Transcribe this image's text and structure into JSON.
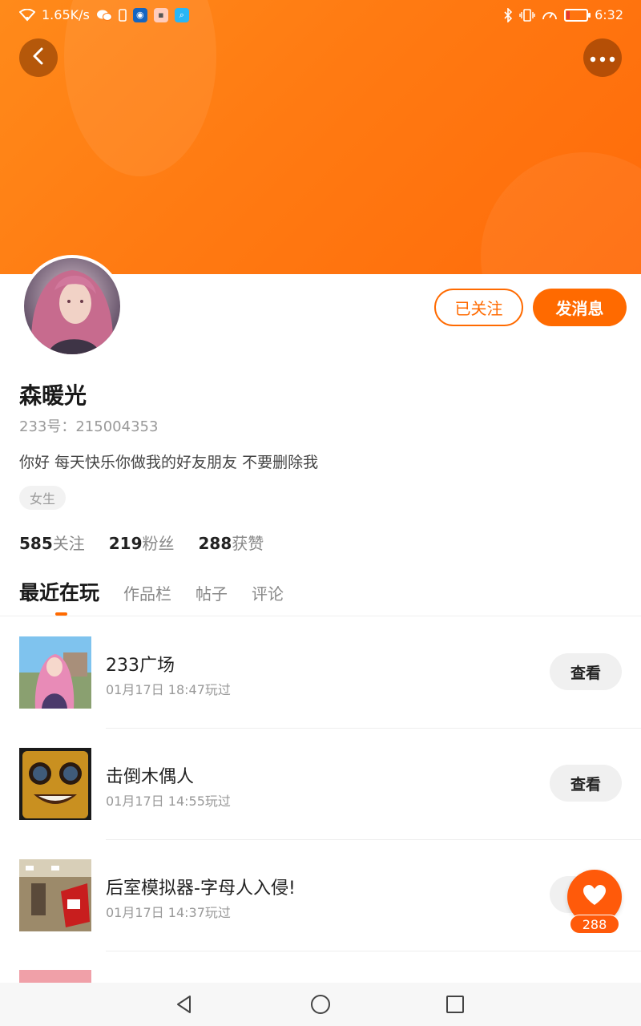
{
  "status_bar": {
    "speed": "1.65K/s",
    "time": "6:32",
    "icons": [
      "wifi-icon",
      "wechat-icon",
      "phone-icon",
      "app-bulb-icon",
      "app-chat-icon",
      "app-search-icon",
      "bluetooth-icon",
      "vibrate-icon",
      "speed-icon",
      "battery-icon"
    ]
  },
  "header": {
    "back_icon": "chevron-left-icon",
    "more_icon": "more-dots-icon",
    "banner_color": "#ff7a12"
  },
  "profile": {
    "follow_label": "已关注",
    "message_label": "发消息",
    "name": "森暖光",
    "id_line": "233号：215004353",
    "bio": "你好 每天快乐你做我的好友朋友 不要删除我",
    "tag": "女生",
    "stats": [
      {
        "num": "585",
        "label": "关注"
      },
      {
        "num": "219",
        "label": "粉丝"
      },
      {
        "num": "288",
        "label": "获赞"
      }
    ]
  },
  "tabs": [
    {
      "label": "最近在玩",
      "active": true
    },
    {
      "label": "作品栏",
      "active": false
    },
    {
      "label": "帖子",
      "active": false
    },
    {
      "label": "评论",
      "active": false
    }
  ],
  "games": [
    {
      "title": "233广场",
      "time": "01月17日 18:47玩过",
      "button": "查看"
    },
    {
      "title": "击倒木偶人",
      "time": "01月17日 14:55玩过",
      "button": "查看"
    },
    {
      "title": "后室模拟器-字母人入侵!",
      "time": "01月17日 14:37玩过",
      "button": "查看"
    }
  ],
  "like_fab": {
    "count": "288",
    "icon": "heart-icon"
  },
  "nav_bar": {
    "icons": [
      "back-triangle-icon",
      "home-circle-icon",
      "recents-square-icon"
    ]
  },
  "colors": {
    "accent": "#ff6a00",
    "fab": "#ff5a0a"
  }
}
